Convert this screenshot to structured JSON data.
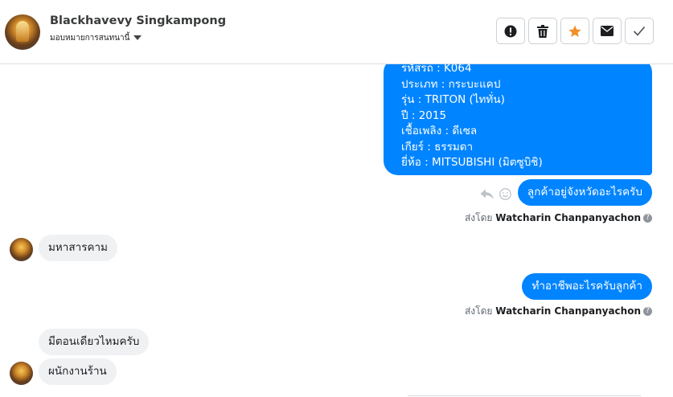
{
  "header": {
    "name": "Blackhavevy Singkampong",
    "subtitle": "มอบหมายการสนทนานี้",
    "toolbar": [
      "alert-icon",
      "trash-icon",
      "star-icon",
      "envelope-icon",
      "check-icon"
    ],
    "star_color": "#f0902a"
  },
  "messages": {
    "card_lines": [
      "รหัสรถ : K064",
      "ประเภท : กระบะแคป",
      "รุ่น : TRITON (ไททั่น)",
      "ปี : 2015",
      "เชื้อเพลิง : ดีเซล",
      "เกียร์ : ธรรมดา",
      "ยี่ห้อ : MITSUBISHI (มิตซูบิชิ)"
    ],
    "out_1": "ลูกค้าอยู่จังหวัดอะไรครับ",
    "sent_by_prefix_1": "ส่งโดย",
    "sent_by_name_1": "Watcharin Chanpanyachon",
    "in_1": "มหาสารคาม",
    "out_2": "ทำอาชีพอะไรครับลูกค้า",
    "sent_by_prefix_2": "ส่งโดย",
    "sent_by_name_2": "Watcharin Chanpanyachon",
    "in_2": "มีตอนเดียวไหมครับ",
    "in_3": "ผนักงานร้าน"
  },
  "colors": {
    "outgoing": "#0084ff",
    "incoming": "#eff1f3"
  }
}
